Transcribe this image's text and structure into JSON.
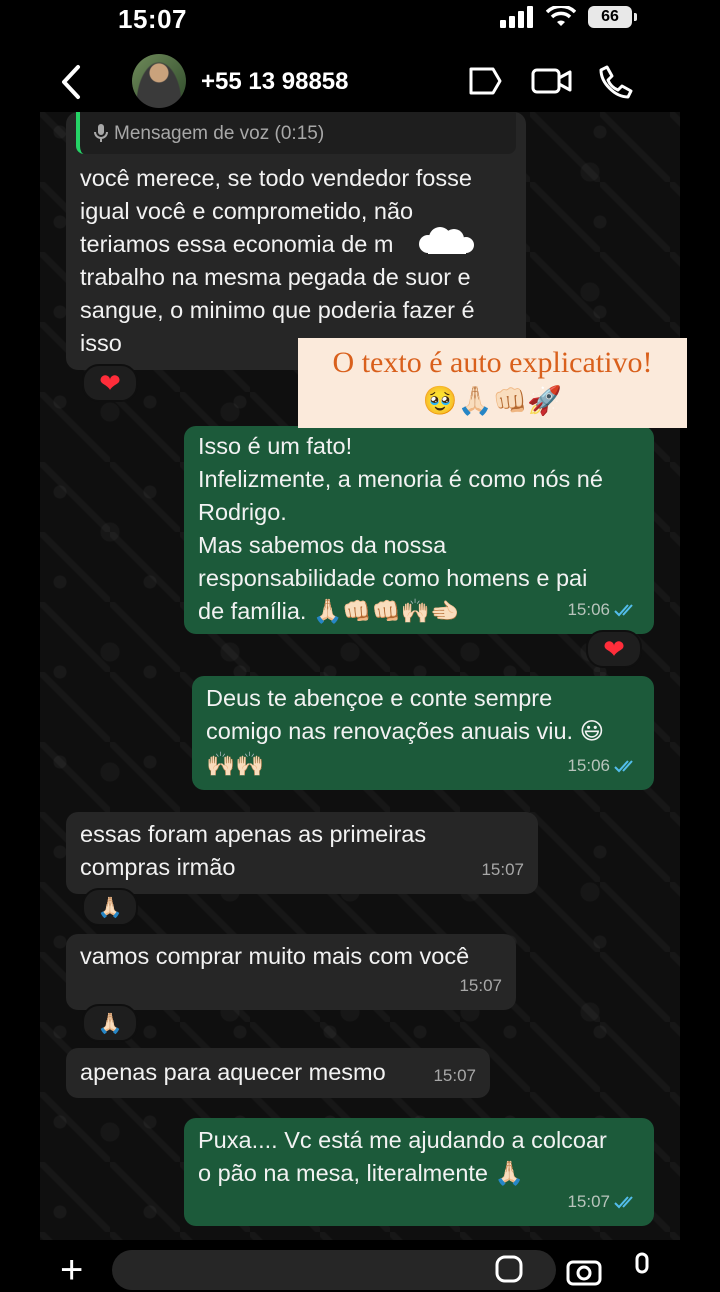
{
  "status": {
    "time": "15:07",
    "battery": "66"
  },
  "header": {
    "contact": "+55 13 98858"
  },
  "messages": {
    "voice_label": "Mensagem de voz (0:15)",
    "m1": "você merece, se todo vendedor fosse\nigual você e comprometido, não\nteriamos essa economia de m\ntrabalho na mesma pegada de suor e\nsangue, o minimo que poderia fazer é\nisso",
    "m2": "Isso é um fato!\nInfelizmente, a menoria é como nós né\nRodrigo.\nMas sabemos da nossa\nresponsabilidade como homens e pai\nde família. 🙏🏻👊🏻👊🏻🙌🏻🫲🏻",
    "m2_time": "15:06",
    "m3": "Deus te abençoe e conte sempre\ncomigo nas renovações anuais viu. 😃\n🙌🏻🙌🏻",
    "m3_time": "15:06",
    "m4": "essas foram apenas as primeiras\ncompras irmão",
    "m4_time": "15:07",
    "m5": "vamos comprar muito mais com você",
    "m5_time": "15:07",
    "m6": "apenas para aquecer mesmo",
    "m6_time": "15:07",
    "m7": "Puxa.... Vc está me ajudando a colcoar\no pão na mesa, literalmente 🙏🏻",
    "m7_time": "15:07"
  },
  "reactions": {
    "heart": "❤",
    "pray": "🙏🏻"
  },
  "overlay": {
    "line1": "O texto é auto explicativo!",
    "line2": "🥹🙏🏻👊🏻🚀"
  },
  "colors": {
    "outgoing": "#1c5a3a",
    "incoming": "#262626",
    "read_ticks": "#53bdeb",
    "accent_note": "#d9601c"
  }
}
